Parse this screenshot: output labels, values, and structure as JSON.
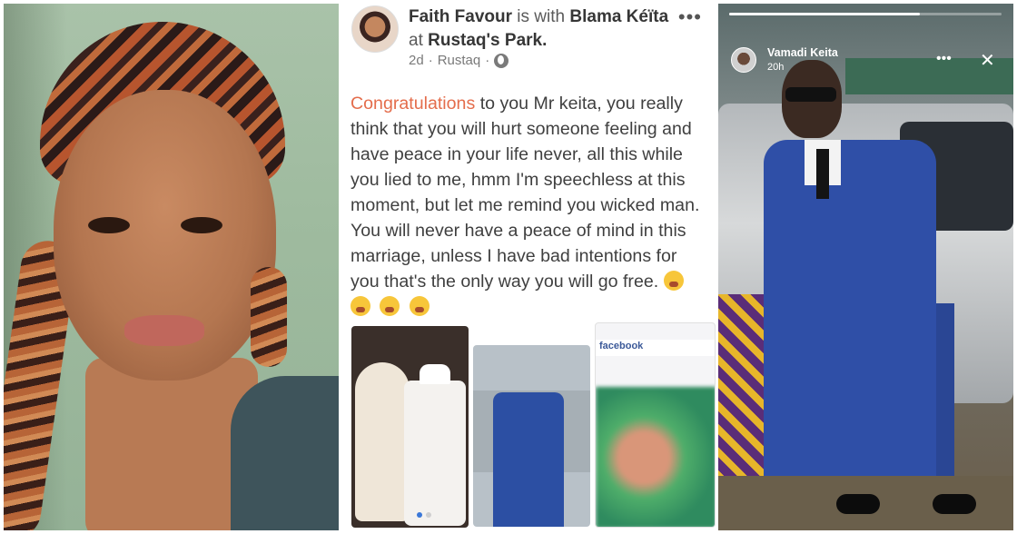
{
  "post": {
    "author": "Faith Favour",
    "with_text": "is with",
    "tagged": "Blama Kéïta",
    "at_text": "at",
    "place": "Rustaq's Park.",
    "time": "2d",
    "separator": "·",
    "location": "Rustaq",
    "more": "•••",
    "text_highlight": "Congratulations",
    "text_body": " to you Mr keita, you really think that you will hurt someone feeling and have peace in your life never, all this while you lied to me, hmm I'm speechless at this moment, but let me remind you wicked man. You will never have a peace of mind in this marriage, unless I have bad intentions for you that's the only way you will go free.",
    "emoji_count": 4,
    "thumb_brand": "facebook"
  },
  "story": {
    "name": "Vamadi Keita",
    "time": "20h",
    "more": "•••",
    "close": "✕",
    "progress": 0.7
  },
  "colors": {
    "highlight": "#e46d4c",
    "facebook_blue": "#3b5998",
    "suit_blue": "#2f4fa7",
    "background_green": "#9fbb9f"
  },
  "icons": {
    "globe": "globe-icon",
    "more": "more-icon",
    "close": "close-icon",
    "emoji": "crying-face-emoji"
  }
}
